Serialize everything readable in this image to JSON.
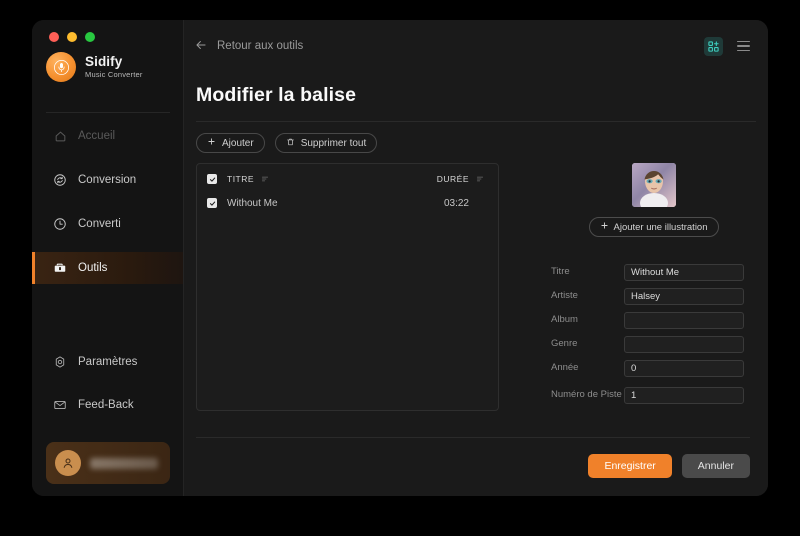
{
  "window": {
    "traffic_lights": [
      "close",
      "minimize",
      "maximize"
    ],
    "colors": {
      "accent": "#f0812a",
      "teal": "#2fbfb0",
      "sidebar_bg": "#141414",
      "main_bg": "#1a1a1a"
    }
  },
  "brand": {
    "name": "Sidify",
    "subtitle": "Music Converter",
    "logo_icon": "sidify-logo-icon"
  },
  "sidebar": {
    "items": [
      {
        "label": "Accueil",
        "icon": "home-icon",
        "state": "disabled"
      },
      {
        "label": "Conversion",
        "icon": "refresh-circle-icon",
        "state": "normal"
      },
      {
        "label": "Converti",
        "icon": "clock-icon",
        "state": "normal"
      },
      {
        "label": "Outils",
        "icon": "toolbox-icon",
        "state": "active"
      }
    ],
    "bottom_items": [
      {
        "label": "Paramètres",
        "icon": "gear-octagon-icon"
      },
      {
        "label": "Feed-Back",
        "icon": "mail-icon"
      }
    ],
    "account": {
      "name": "",
      "avatar_icon": "user-avatar-icon",
      "redacted": true
    }
  },
  "topbar": {
    "back_label": "Retour aux outils",
    "back_icon": "arrow-left-icon",
    "grid_icon": "grid-plus-icon",
    "menu_icon": "hamburger-menu-icon"
  },
  "page": {
    "title": "Modifier la balise"
  },
  "toolbar": {
    "add_label": "Ajouter",
    "add_icon": "plus-icon",
    "delete_all_label": "Supprimer tout",
    "delete_all_icon": "trash-icon"
  },
  "table": {
    "select_all_checked": true,
    "columns": [
      {
        "label": "TITRE",
        "sort_icon": "sort-icon"
      },
      {
        "label": "DURÉE",
        "sort_icon": "sort-icon"
      }
    ],
    "rows": [
      {
        "checked": true,
        "title": "Without Me",
        "duration": "03:22"
      }
    ]
  },
  "artwork": {
    "add_label": "Ajouter une illustration",
    "add_icon": "plus-icon",
    "image_alt": "album-cover-portrait"
  },
  "form": {
    "fields": [
      {
        "label": "Titre",
        "value": "Without Me",
        "placeholder": ""
      },
      {
        "label": "Artiste",
        "value": "Halsey",
        "placeholder": ""
      },
      {
        "label": "Album",
        "value": "",
        "placeholder": ""
      },
      {
        "label": "Genre",
        "value": "",
        "placeholder": ""
      },
      {
        "label": "Année",
        "value": "0",
        "placeholder": ""
      },
      {
        "label": "Numéro de Piste",
        "value": "1",
        "placeholder": ""
      }
    ]
  },
  "actions": {
    "save_label": "Enregistrer",
    "cancel_label": "Annuler"
  }
}
